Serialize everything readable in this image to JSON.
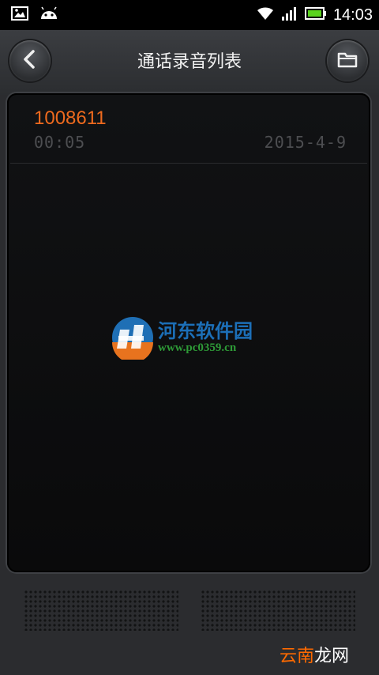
{
  "status_bar": {
    "time": "14:03",
    "icons": [
      "image-icon",
      "android-icon",
      "wifi-icon",
      "signal-icon",
      "battery-icon"
    ]
  },
  "header": {
    "title": "通话录音列表",
    "back_icon": "back-icon",
    "folder_icon": "folder-icon"
  },
  "recordings": [
    {
      "number": "1008611",
      "duration": "00:05",
      "date": "2015-4-9"
    }
  ],
  "watermark": {
    "name": "河东软件园",
    "url": "www.pc0359.cn"
  },
  "bottom_watermark": {
    "part1": "云南",
    "part2": "龙网"
  },
  "colors": {
    "accent": "#ee6a1e",
    "panel": "#0c0c0d",
    "background": "#2b2c2f"
  }
}
